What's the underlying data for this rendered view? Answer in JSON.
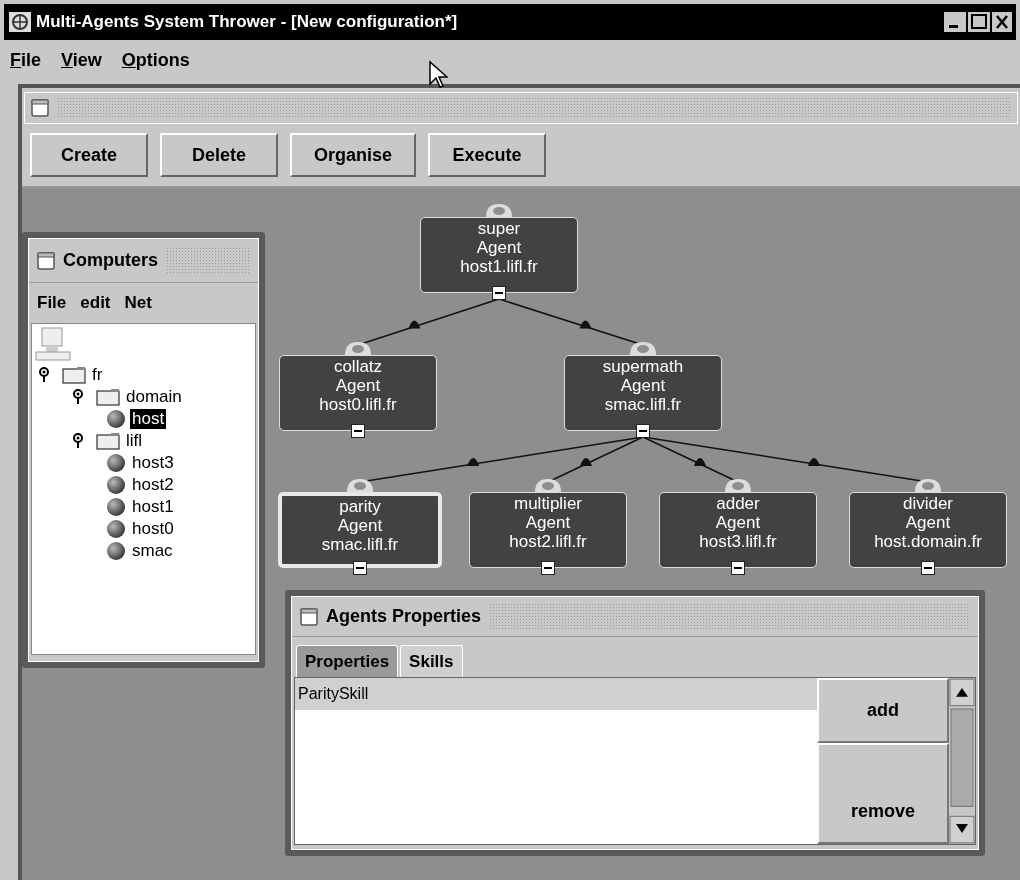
{
  "window": {
    "title": "Multi-Agents System Thrower - [New configuration*]"
  },
  "menu": [
    "File",
    "View",
    "Options"
  ],
  "toolbar": [
    "Create",
    "Delete",
    "Organise",
    "Execute"
  ],
  "computers": {
    "title": "Computers",
    "menu": [
      "File",
      "edit",
      "Net"
    ],
    "tree": [
      {
        "label": "fr",
        "kind": "folder",
        "expanded": true,
        "selected": false,
        "children": [
          {
            "label": "domain",
            "kind": "folder",
            "expanded": true,
            "selected": false,
            "children": [
              {
                "label": "host",
                "kind": "host",
                "selected": true
              }
            ]
          },
          {
            "label": "lifl",
            "kind": "folder",
            "expanded": true,
            "selected": false,
            "children": [
              {
                "label": "host3",
                "kind": "host",
                "selected": false
              },
              {
                "label": "host2",
                "kind": "host",
                "selected": false
              },
              {
                "label": "host1",
                "kind": "host",
                "selected": false
              },
              {
                "label": "host0",
                "kind": "host",
                "selected": false
              },
              {
                "label": "smac",
                "kind": "host",
                "selected": false
              }
            ]
          }
        ]
      }
    ]
  },
  "agents": [
    {
      "name": "super",
      "type": "Agent",
      "host": "host1.lifl.fr",
      "selected": false,
      "children": [
        {
          "name": "collatz",
          "type": "Agent",
          "host": "host0.lifl.fr",
          "selected": false
        },
        {
          "name": "supermath",
          "type": "Agent",
          "host": "smac.lifl.fr",
          "selected": false,
          "children": [
            {
              "name": "parity",
              "type": "Agent",
              "host": "smac.lifl.fr",
              "selected": true
            },
            {
              "name": "multiplier",
              "type": "Agent",
              "host": "host2.lifl.fr",
              "selected": false
            },
            {
              "name": "adder",
              "type": "Agent",
              "host": "host3.lifl.fr",
              "selected": false
            },
            {
              "name": "divider",
              "type": "Agent",
              "host": "host.domain.fr",
              "selected": false
            }
          ]
        }
      ]
    }
  ],
  "properties": {
    "title": "Agents Properties",
    "tabs": [
      {
        "label": "Properties",
        "selected": false
      },
      {
        "label": "Skills",
        "selected": true
      }
    ],
    "skills": [
      {
        "label": "ParitySkill",
        "selected": true
      }
    ],
    "buttons": [
      "add",
      "remove"
    ]
  }
}
